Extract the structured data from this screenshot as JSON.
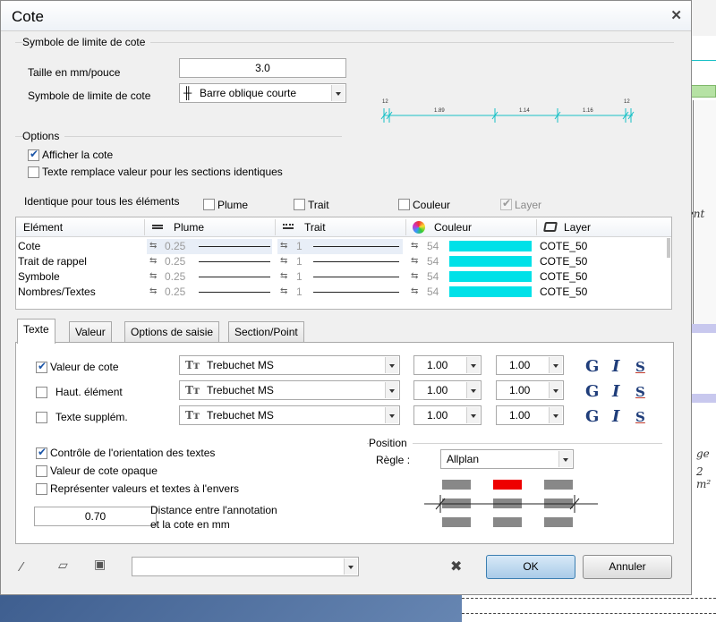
{
  "dialog": {
    "title": "Cote",
    "close_glyph": "✕"
  },
  "symbole_group": {
    "label": "Symbole de limite de cote",
    "taille_label": "Taille en mm/pouce",
    "taille_value": "3.0",
    "symbole_label": "Symbole de limite de cote",
    "symbole_value": "Barre oblique courte",
    "symbole_glyph": "╫"
  },
  "preview": {
    "labels": [
      "12",
      "1.89",
      "1.14",
      "1.16",
      "12"
    ],
    "line_color": "#17c0c6"
  },
  "options_group": {
    "label": "Options",
    "afficher": {
      "label": "Afficher la cote",
      "checked": true
    },
    "texte_remplace": {
      "label": "Texte remplace valeur pour les sections identiques",
      "checked": false
    }
  },
  "identique": {
    "label": "Identique pour tous les éléments",
    "plume": "Plume",
    "trait": "Trait",
    "couleur": "Couleur",
    "layer": "Layer"
  },
  "table": {
    "headers": [
      "Elément",
      "Plume",
      "Trait",
      "Couleur",
      "Layer"
    ],
    "rows": [
      {
        "element": "Cote",
        "plume": "0.25",
        "trait": "1",
        "couleur": "54",
        "layer": "COTE_50"
      },
      {
        "element": "Trait de rappel",
        "plume": "0.25",
        "trait": "1",
        "couleur": "54",
        "layer": "COTE_50"
      },
      {
        "element": "Symbole",
        "plume": "0.25",
        "trait": "1",
        "couleur": "54",
        "layer": "COTE_50"
      },
      {
        "element": "Nombres/Textes",
        "plume": "0.25",
        "trait": "1",
        "couleur": "54",
        "layer": "COTE_50"
      }
    ],
    "color_swatch": "#00e1e8"
  },
  "tabs": [
    "Texte",
    "Valeur",
    "Options de saisie",
    "Section/Point"
  ],
  "texte_tab": {
    "rows": [
      {
        "label": "Valeur de cote",
        "checked": true,
        "font": "Trebuchet MS",
        "h": "1.00",
        "w": "1.00"
      },
      {
        "label": "Haut. élément",
        "checked": false,
        "font": "Trebuchet MS",
        "h": "1.00",
        "w": "1.00"
      },
      {
        "label": "Texte supplém.",
        "checked": false,
        "font": "Trebuchet MS",
        "h": "1.00",
        "w": "1.00"
      }
    ],
    "font_glyph": "Tт",
    "style_g": "G",
    "style_i": "I",
    "style_s": "S",
    "controle": {
      "label": "Contrôle de l'orientation des textes",
      "checked": true
    },
    "opaque": {
      "label": "Valeur de cote opaque",
      "checked": false
    },
    "envers": {
      "label": "Représenter valeurs et textes à l'envers",
      "checked": false
    },
    "distance_value": "0.70",
    "distance_label_1": "Distance entre l'annotation",
    "distance_label_2": "et la cote en mm",
    "position_label": "Position",
    "regle_label": "Règle :",
    "regle_value": "Allplan",
    "selected_color": "#ee0000"
  },
  "footer": {
    "combo_value": "",
    "ok": "OK",
    "annuler": "Annuler"
  },
  "background": {
    "text1": "lient",
    "text2": "ge",
    "text3": "2 m²"
  }
}
